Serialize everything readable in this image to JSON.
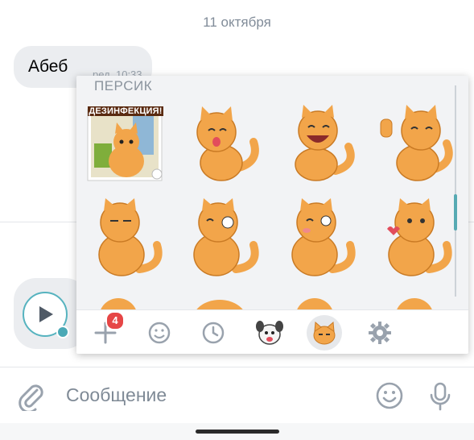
{
  "chat": {
    "date_divider": "11 октября",
    "message": {
      "text": "Абеб",
      "meta": "ред. 10:33"
    }
  },
  "sticker_panel": {
    "pack_title": "ПЕРСИК",
    "stickers": [
      {
        "id": "sticker-1",
        "caption": "ДЕЗИНФЕКЦИЯ!"
      },
      {
        "id": "sticker-2"
      },
      {
        "id": "sticker-3"
      },
      {
        "id": "sticker-4"
      },
      {
        "id": "sticker-5"
      },
      {
        "id": "sticker-6"
      },
      {
        "id": "sticker-7"
      },
      {
        "id": "sticker-8"
      }
    ],
    "tabs": [
      {
        "icon": "add-icon",
        "badge": "4"
      },
      {
        "icon": "emoji-icon"
      },
      {
        "icon": "recent-clock-icon"
      },
      {
        "icon": "dog-sticker-pack-icon"
      },
      {
        "icon": "cat-sticker-pack-icon",
        "selected": true
      },
      {
        "icon": "settings-gear-icon"
      }
    ]
  },
  "composer": {
    "placeholder": "Сообщение"
  },
  "colors": {
    "accent": "#56b3bf",
    "badge": "#e64646",
    "cat_orange": "#f2a54a"
  }
}
